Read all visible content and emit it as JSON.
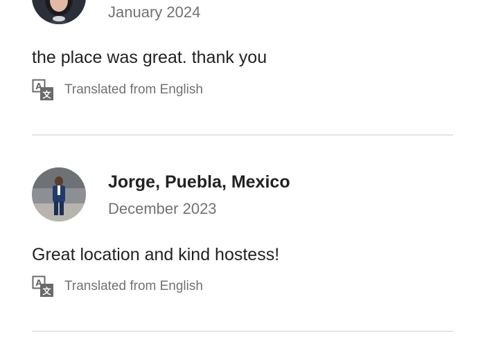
{
  "colors": {
    "text_primary": "#222222",
    "text_secondary": "#717171",
    "divider": "#e4e4e4"
  },
  "reviews": [
    {
      "name": "",
      "date": "January 2024",
      "text": "the place was great. thank you",
      "translation_note": "Translated from English",
      "translation_icon": "translate-icon"
    },
    {
      "name": "Jorge, Puebla, Mexico",
      "date": "December 2023",
      "text": "Great location and kind hostess!",
      "translation_note": "Translated from English",
      "translation_icon": "translate-icon"
    }
  ]
}
